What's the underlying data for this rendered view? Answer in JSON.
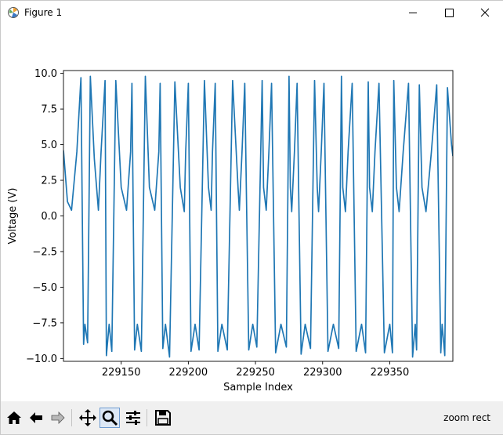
{
  "window": {
    "title": "Figure 1"
  },
  "toolbar": {
    "buttons": [
      {
        "name": "home",
        "icon": "home-icon"
      },
      {
        "name": "back",
        "icon": "back-arrow-icon"
      },
      {
        "name": "forward",
        "icon": "forward-arrow-icon"
      },
      {
        "name": "pan",
        "icon": "move-icon"
      },
      {
        "name": "zoom",
        "icon": "zoom-icon"
      },
      {
        "name": "configure",
        "icon": "sliders-icon"
      },
      {
        "name": "save",
        "icon": "save-icon"
      }
    ],
    "status": "zoom rect"
  },
  "chart_data": {
    "type": "line",
    "title": "",
    "xlabel": "Sample Index",
    "ylabel": "Voltage (V)",
    "xlim": [
      229107,
      229397
    ],
    "ylim": [
      -10.2,
      10.2
    ],
    "xticks": [
      229150,
      229200,
      229250,
      229300,
      229350
    ],
    "yticks": [
      10.0,
      7.5,
      5.0,
      2.5,
      0.0,
      -2.5,
      -5.0,
      -7.5,
      -10.0
    ],
    "ytick_labels": [
      "10.0",
      "7.5",
      "5.0",
      "2.5",
      "0.0",
      "−2.5",
      "−5.0",
      "−7.5",
      "−10.0"
    ],
    "grid": false,
    "color": "#1f77b4",
    "series": [
      {
        "x": [
          229107,
          229110,
          229113,
          229117,
          229120,
          229122,
          229123,
          229125,
          229127,
          229130,
          229133,
          229135,
          229138,
          229139,
          229141,
          229143,
          229146,
          229150,
          229154,
          229157,
          229158,
          229160,
          229162,
          229165,
          229168,
          229171,
          229175,
          229178,
          229179,
          229181,
          229183,
          229186,
          229190,
          229194,
          229197,
          229198,
          229200,
          229202,
          229205,
          229208,
          229212,
          229215,
          229217,
          229218,
          229220,
          229222,
          229225,
          229229,
          229233,
          229237,
          229238,
          229240,
          229242,
          229245,
          229248,
          229251,
          229255,
          229256,
          229258,
          229260,
          229262,
          229265,
          229269,
          229273,
          229275,
          229276,
          229277,
          229279,
          229281,
          229284,
          229287,
          229291,
          229294,
          229296,
          229297,
          229299,
          229301,
          229304,
          229308,
          229312,
          229314,
          229315,
          229317,
          229319,
          229322,
          229325,
          229329,
          229332,
          229334,
          229335,
          229337,
          229339,
          229342,
          229346,
          229350,
          229352,
          229353,
          229355,
          229357,
          229360,
          229364,
          229367,
          229369,
          229370,
          229372,
          229374,
          229377,
          229381,
          229385,
          229388,
          229389,
          229391,
          229393,
          229396,
          229397
        ],
        "y": [
          4.6,
          1.0,
          0.4,
          4.5,
          9.7,
          -9.0,
          -7.6,
          -8.9,
          9.8,
          4.0,
          0.4,
          4.5,
          9.5,
          -9.8,
          -7.6,
          -9.5,
          9.5,
          2.0,
          0.4,
          4.5,
          9.3,
          -9.4,
          -7.6,
          -9.5,
          9.8,
          2.0,
          0.4,
          4.5,
          9.3,
          -9.3,
          -7.6,
          -9.9,
          9.4,
          2.0,
          0.3,
          4.5,
          9.3,
          -9.5,
          -7.6,
          -9.4,
          9.5,
          2.0,
          0.4,
          4.5,
          9.3,
          -9.5,
          -7.6,
          -9.4,
          9.5,
          2.0,
          0.4,
          4.5,
          9.3,
          -9.4,
          -7.6,
          -9.2,
          9.5,
          2.0,
          0.4,
          4.5,
          9.3,
          -9.6,
          -7.6,
          -9.2,
          9.8,
          2.0,
          0.3,
          4.5,
          9.3,
          -9.7,
          -7.6,
          -9.3,
          9.5,
          2.0,
          0.3,
          4.5,
          9.3,
          -9.5,
          -7.6,
          -9.3,
          9.8,
          2.0,
          0.3,
          4.5,
          9.3,
          -9.5,
          -7.6,
          -9.6,
          9.4,
          2.0,
          0.3,
          4.5,
          9.3,
          -9.6,
          -7.6,
          -9.6,
          9.5,
          2.0,
          0.3,
          4.5,
          9.3,
          -9.9,
          -7.6,
          -9.4,
          9.2,
          2.0,
          0.3,
          4.5,
          9.2,
          -9.6,
          -7.6,
          -9.8,
          9.0,
          5.0,
          4.2
        ]
      }
    ]
  }
}
